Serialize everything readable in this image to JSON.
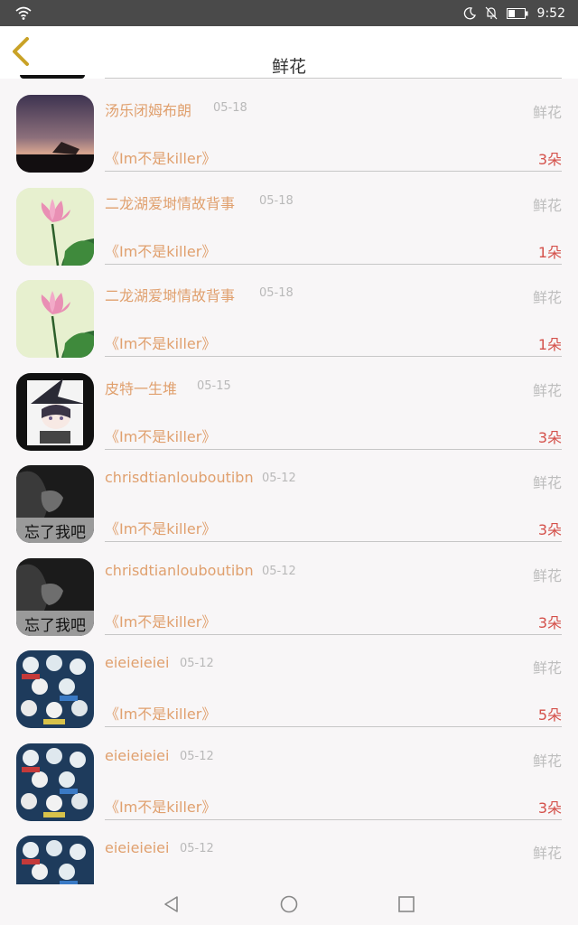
{
  "status_bar": {
    "time": "9:52"
  },
  "header": {
    "title": "鲜花"
  },
  "rows": [
    {
      "name": "汤乐闭姆布朗",
      "date": "05-18",
      "kind": "鲜花",
      "book": "《Im不是killer》",
      "count": "3朵",
      "avatar": "night-sky-avatar"
    },
    {
      "name": "二龙湖爱埘情故背事",
      "date": "05-18",
      "kind": "鲜花",
      "book": "《Im不是killer》",
      "count": "1朵",
      "avatar": "lotus-avatar"
    },
    {
      "name": "二龙湖爱埘情故背事",
      "date": "05-18",
      "kind": "鲜花",
      "book": "《Im不是killer》",
      "count": "1朵",
      "avatar": "lotus-avatar"
    },
    {
      "name": "皮特一生堆",
      "date": "05-15",
      "kind": "鲜花",
      "book": "《Im不是killer》",
      "count": "3朵",
      "avatar": "witch-anime-avatar"
    },
    {
      "name": "chrisdtianlouboutibn",
      "date": "05-12",
      "kind": "鲜花",
      "book": "《Im不是killer》",
      "count": "3朵",
      "avatar": "bw-portrait-avatar",
      "avatar_text": "忘了我吧"
    },
    {
      "name": "chrisdtianlouboutibn",
      "date": "05-12",
      "kind": "鲜花",
      "book": "《Im不是killer》",
      "count": "3朵",
      "avatar": "bw-portrait-avatar",
      "avatar_text": "忘了我吧"
    },
    {
      "name": "eieieieiei",
      "date": "05-12",
      "kind": "鲜花",
      "book": "《Im不是killer》",
      "count": "5朵",
      "avatar": "skeleton-collage-avatar"
    },
    {
      "name": "eieieieiei",
      "date": "05-12",
      "kind": "鲜花",
      "book": "《Im不是killer》",
      "count": "3朵",
      "avatar": "skeleton-collage-avatar"
    },
    {
      "name": "eieieieiei",
      "date": "05-12",
      "kind": "鲜花",
      "book": "",
      "count": "",
      "avatar": "skeleton-collage-avatar"
    }
  ],
  "colors": {
    "accent": "#e0a06e",
    "count": "#d4504a",
    "muted": "#b9b9b9",
    "back_arrow": "#c9a227"
  }
}
